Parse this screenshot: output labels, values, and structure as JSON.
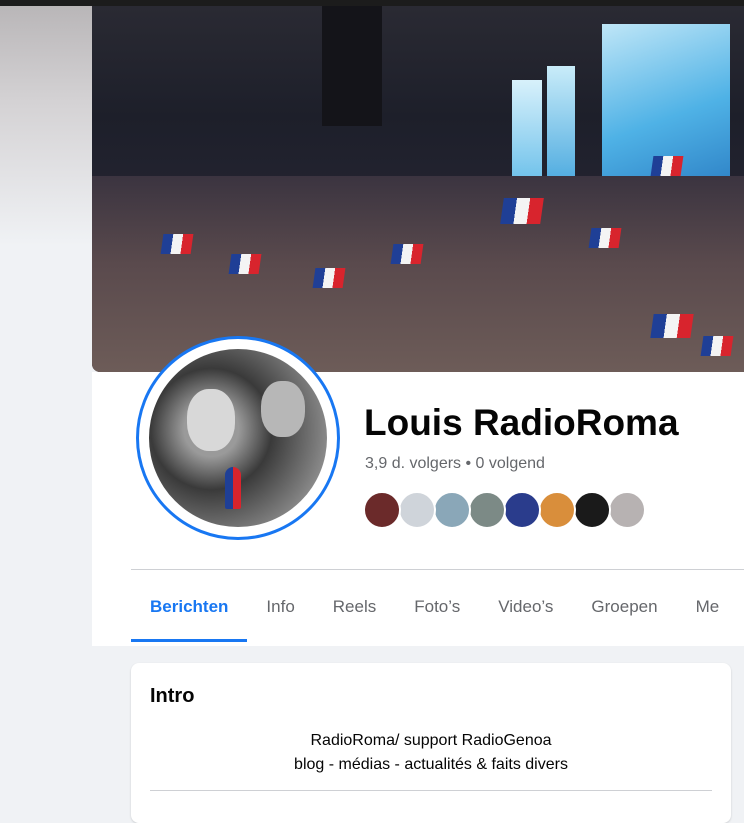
{
  "profile": {
    "name": "Louis RadioRoma",
    "stats": "3,9 d. volgers • 0 volgend"
  },
  "friends_preview": [
    {
      "icon": "friend-avatar-1",
      "color": "#6b2a2a"
    },
    {
      "icon": "friend-avatar-2",
      "color": "#cfd4da"
    },
    {
      "icon": "friend-avatar-3",
      "color": "#8aa7b8"
    },
    {
      "icon": "friend-avatar-4",
      "color": "#7c8a86"
    },
    {
      "icon": "friend-avatar-5",
      "color": "#2a3c8c"
    },
    {
      "icon": "friend-avatar-6",
      "color": "#d98e3b"
    },
    {
      "icon": "friend-avatar-7",
      "color": "#1a1a1a"
    },
    {
      "icon": "friend-avatar-8",
      "color": "#b7b2b2"
    }
  ],
  "tabs": [
    {
      "label": "Berichten",
      "active": true
    },
    {
      "label": "Info"
    },
    {
      "label": "Reels"
    },
    {
      "label": "Foto’s"
    },
    {
      "label": "Video’s"
    },
    {
      "label": "Groepen"
    },
    {
      "label": "Me"
    }
  ],
  "intro": {
    "title": "Intro",
    "bio_line1": "RadioRoma/ support RadioGenoa",
    "bio_line2": "blog - médias - actualités & faits divers"
  },
  "colors": {
    "accent": "#1877f2",
    "text_primary": "#050505",
    "text_secondary": "#65676b",
    "page_bg": "#f0f2f5"
  }
}
